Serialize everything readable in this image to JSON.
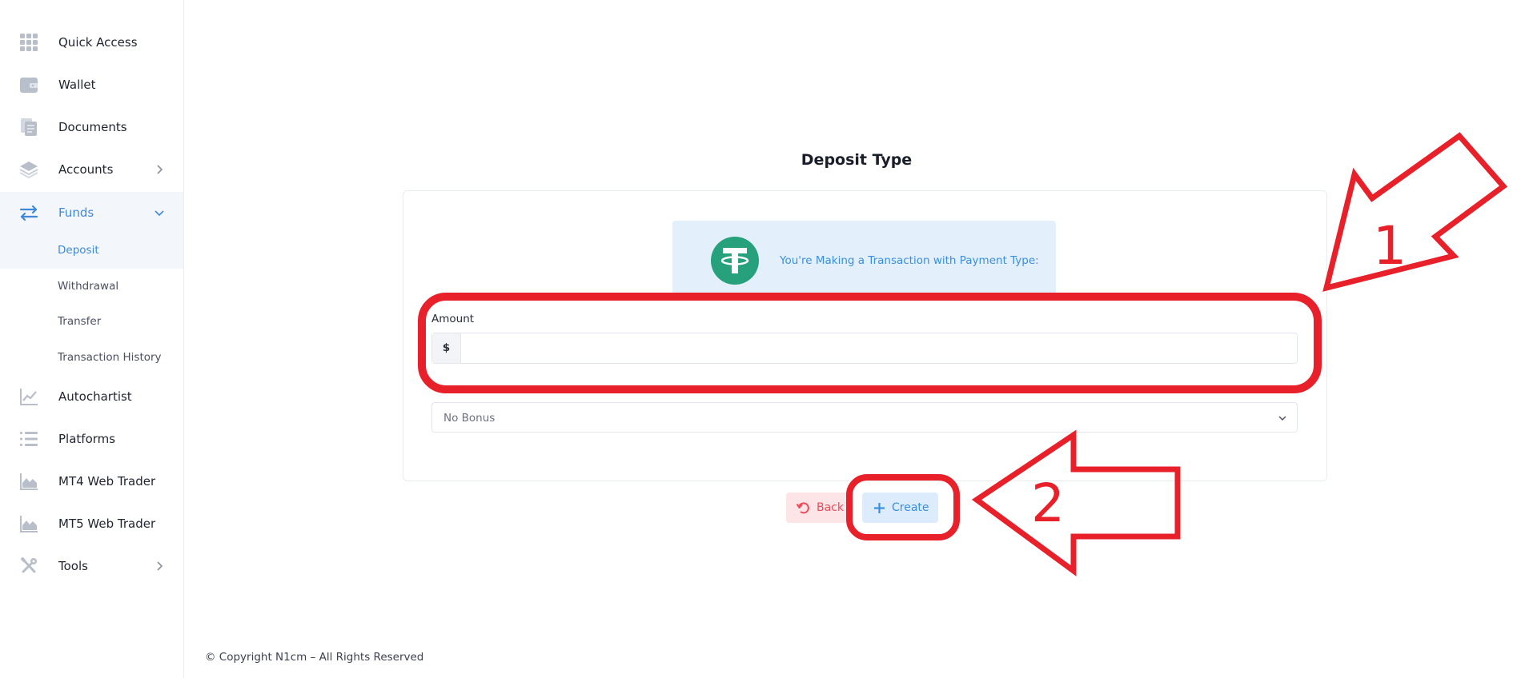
{
  "sidebar": {
    "items": [
      {
        "label": "Quick Access",
        "icon": "grid-icon"
      },
      {
        "label": "Wallet",
        "icon": "wallet-icon"
      },
      {
        "label": "Documents",
        "icon": "documents-icon"
      },
      {
        "label": "Accounts",
        "icon": "layers-icon"
      },
      {
        "label": "Funds",
        "icon": "transfer-arrows-icon",
        "active": true
      },
      {
        "label": "Autochartist",
        "icon": "chart-line-icon"
      },
      {
        "label": "Platforms",
        "icon": "list-icon"
      },
      {
        "label": "MT4 Web Trader",
        "icon": "area-chart-icon"
      },
      {
        "label": "MT5 Web Trader",
        "icon": "area-chart-icon"
      },
      {
        "label": "Tools",
        "icon": "tools-icon"
      }
    ],
    "funds_submenu": [
      {
        "label": "Deposit",
        "active": true
      },
      {
        "label": "Withdrawal"
      },
      {
        "label": "Transfer"
      },
      {
        "label": "Transaction History"
      }
    ]
  },
  "main": {
    "title": "Deposit Type",
    "payment_banner": {
      "text": "You're Making a Transaction with Payment Type:",
      "icon": "tether-logo-icon"
    },
    "amount": {
      "label": "Amount",
      "currency_symbol": "$",
      "value": ""
    },
    "bonus": {
      "label": "",
      "selected": "No Bonus"
    },
    "buttons": {
      "back_label": "Back",
      "create_label": "Create"
    }
  },
  "footer": {
    "copyright": "© Copyright N1cm – All Rights Reserved"
  },
  "annotations": {
    "marker_1": "1",
    "marker_2": "2"
  },
  "colors": {
    "accent": "#3f8ad8",
    "danger": "#ee4b5a",
    "tether_green": "#26a17b",
    "annotation_red": "#e8202a",
    "banner_bg": "#e3f0fc"
  }
}
